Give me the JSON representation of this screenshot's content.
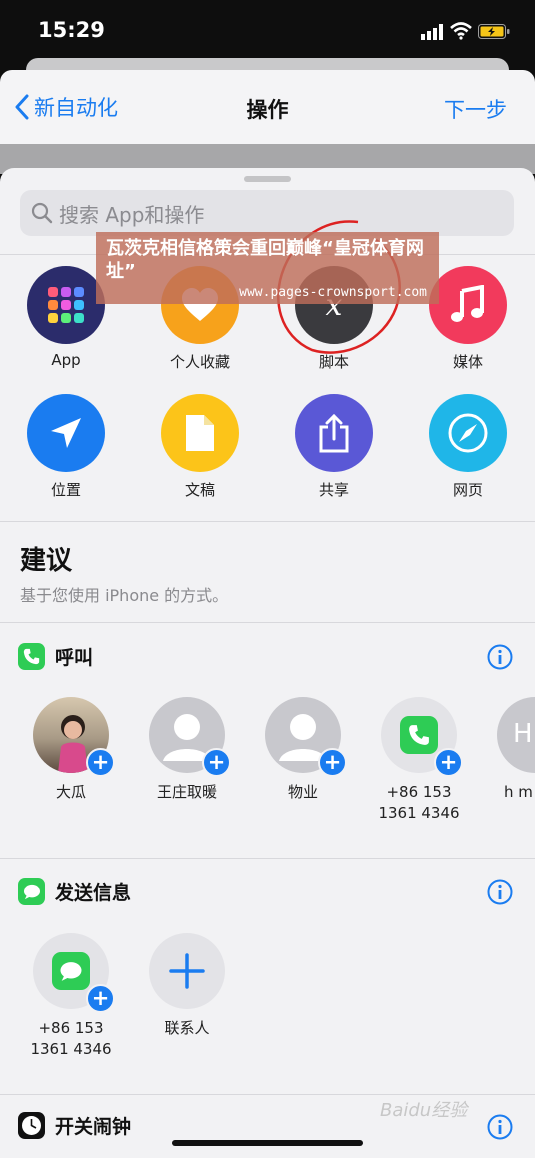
{
  "status": {
    "time": "15:29"
  },
  "nav": {
    "back_label": "新自动化",
    "title": "操作",
    "next_label": "下一步",
    "accent": "#1a7cf0"
  },
  "search": {
    "placeholder": "搜索 App和操作"
  },
  "categories": [
    {
      "label": "App",
      "icon": "app-grid-icon",
      "color": "#2b2c6b"
    },
    {
      "label": "个人收藏",
      "icon": "heart-icon",
      "color": "#f7a21b"
    },
    {
      "label": "脚本",
      "icon": "script-x-icon",
      "color": "#3a3a3e"
    },
    {
      "label": "媒体",
      "icon": "music-note-icon",
      "color": "#f23a5c"
    },
    {
      "label": "位置",
      "icon": "location-arrow-icon",
      "color": "#1a7cf0"
    },
    {
      "label": "文稿",
      "icon": "document-icon",
      "color": "#fcc419"
    },
    {
      "label": "共享",
      "icon": "share-icon",
      "color": "#5a58d6"
    },
    {
      "label": "网页",
      "icon": "compass-icon",
      "color": "#1fb6e8"
    }
  ],
  "suggestions": {
    "title": "建议",
    "subtitle": "基于您使用 iPhone 的方式。"
  },
  "call_group": {
    "title": "呼叫",
    "contacts": [
      {
        "name": "大瓜",
        "sub": ""
      },
      {
        "name": "王庄取暖",
        "sub": ""
      },
      {
        "name": "物业",
        "sub": ""
      },
      {
        "name": "+86 153",
        "sub": "1361 4346"
      },
      {
        "name": "h m",
        "sub": ""
      }
    ]
  },
  "message_group": {
    "title": "发送信息",
    "contacts": [
      {
        "name": "+86 153",
        "sub": "1361 4346"
      },
      {
        "name": "联系人",
        "sub": ""
      }
    ]
  },
  "alarm_group": {
    "title": "开关闹钟"
  },
  "overlay": {
    "text": "瓦茨克相信格策会重回巅峰“皇冠体育网址”",
    "url": "www.pages-crownsport.com"
  },
  "watermark": {
    "text": "Baidu经验"
  }
}
